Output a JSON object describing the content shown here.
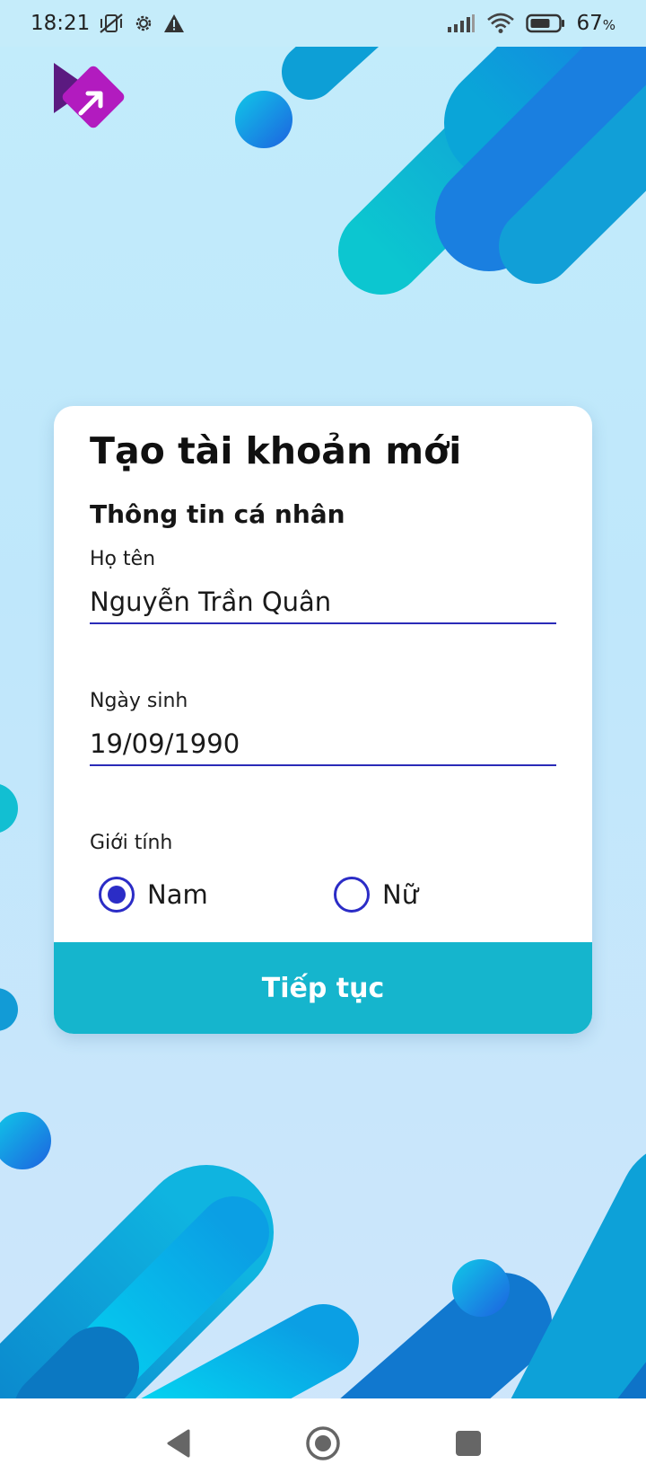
{
  "status_bar": {
    "time": "18:21",
    "battery": "67",
    "battery_unit": "%",
    "left_icons": [
      "vibrate-off-icon",
      "settings-gear-icon",
      "warning-icon"
    ],
    "right_icons": [
      "signal-icon",
      "wifi-icon",
      "battery-icon"
    ]
  },
  "app": {
    "logo_icon": "app-logo-icon",
    "logo_colors": [
      "#5b1a80",
      "#b21bbf"
    ]
  },
  "form": {
    "title": "Tạo tài khoản mới",
    "section_title": "Thông tin cá nhân",
    "name": {
      "label": "Họ tên",
      "value": "Nguyễn Trần Quân"
    },
    "birthdate": {
      "label": "Ngày sinh",
      "value": "19/09/1990"
    },
    "gender": {
      "label": "Giới tính",
      "options": [
        {
          "label": "Nam",
          "selected": true
        },
        {
          "label": "Nữ",
          "selected": false
        }
      ]
    },
    "continue_label": "Tiếp tục"
  },
  "colors": {
    "accent": "#2b2cc6",
    "button": "#15b5cd",
    "background": "#c2ecfb"
  },
  "nav_bar": {
    "icons": [
      "back-triangle-icon",
      "home-circle-icon",
      "recents-square-icon"
    ]
  }
}
